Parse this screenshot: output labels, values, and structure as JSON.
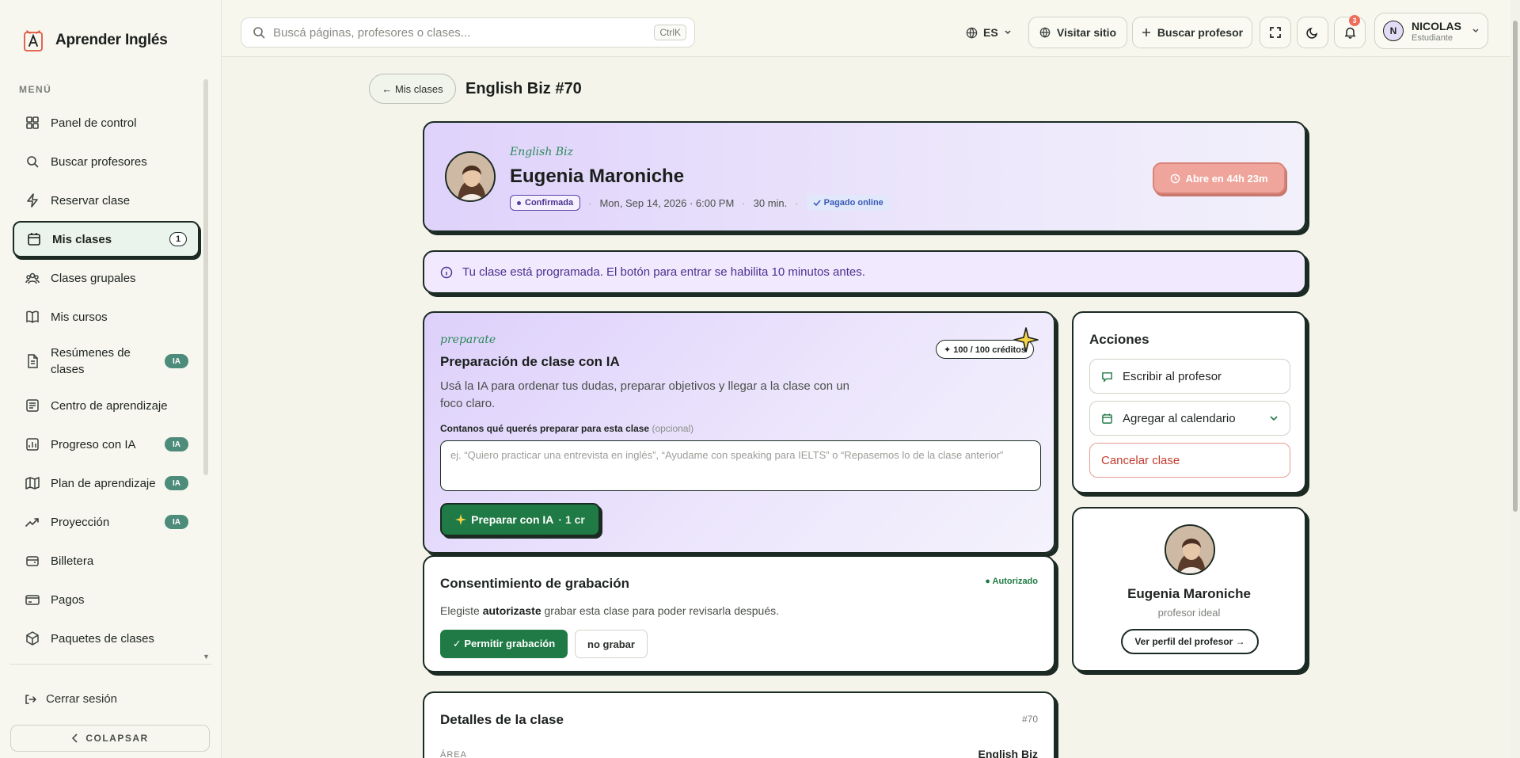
{
  "brand": {
    "name": "Aprender Inglés"
  },
  "sidebar": {
    "menu_label": "MENÚ",
    "items": [
      {
        "label": "Panel de control",
        "icon": "grid-icon"
      },
      {
        "label": "Buscar profesores",
        "icon": "search-icon"
      },
      {
        "label": "Reservar clase",
        "icon": "bolt-icon"
      },
      {
        "label": "Mis clases",
        "icon": "calendar-icon",
        "badge": "1",
        "active": true
      },
      {
        "label": "Clases grupales",
        "icon": "group-icon"
      },
      {
        "label": "Mis cursos",
        "icon": "book-icon"
      },
      {
        "label": "Resúmenes de clases",
        "icon": "document-icon",
        "badge": "IA"
      },
      {
        "label": "Centro de aprendizaje",
        "icon": "notes-icon"
      },
      {
        "label": "Progreso con IA",
        "icon": "chart-icon",
        "badge": "IA"
      },
      {
        "label": "Plan de aprendizaje",
        "icon": "map-icon",
        "badge": "IA"
      },
      {
        "label": "Proyección",
        "icon": "trend-icon",
        "badge": "IA"
      },
      {
        "label": "Billetera",
        "icon": "wallet-icon"
      },
      {
        "label": "Pagos",
        "icon": "card-icon"
      },
      {
        "label": "Paquetes de clases",
        "icon": "box-icon"
      }
    ],
    "logout": "Cerrar sesión",
    "collapse": "COLAPSAR"
  },
  "topbar": {
    "search_placeholder": "Buscá páginas, profesores o clases...",
    "search_shortcut": "CtrlK",
    "language": "ES",
    "visit_site": "Visitar sitio",
    "find_teacher": "Buscar profesor",
    "notifications_count": "3",
    "user": {
      "initial": "N",
      "name": "NICOLAS",
      "role": "Estudiante"
    }
  },
  "page": {
    "back": "← Mis clases",
    "title": "English Biz #70"
  },
  "lesson": {
    "course": "English Biz",
    "teacher": "Eugenia Maroniche",
    "status": "Confirmada",
    "datetime": "Mon, Sep 14, 2026 · 6:00 PM",
    "duration": "30 min.",
    "payment": "Pagado online",
    "open_in": "Abre en 44h 23m"
  },
  "info_banner": "Tu clase está programada. El botón para entrar se habilita 10 minutos antes.",
  "prep": {
    "kicker": "preparate",
    "title": "Preparación de clase con IA",
    "credits": "✦ 100 / 100 créditos",
    "description": "Usá la IA para ordenar tus dudas, preparar objetivos y llegar a la clase con un foco claro.",
    "field_label": "Contanos qué querés preparar para esta clase",
    "field_optional": "(opcional)",
    "field_placeholder": "ej. “Quiero practicar una entrevista en inglés”, “Ayudame con speaking para IELTS” o “Repasemos lo de la clase anterior”",
    "button": "Preparar con IA",
    "button_cost": "· 1 cr"
  },
  "consent": {
    "title": "Consentimiento de grabación",
    "status": "● Autorizado",
    "text_pre": "Elegiste ",
    "text_bold": "autorizaste",
    "text_post": " grabar esta clase para poder revisarla después.",
    "allow": "✓ Permitir grabación",
    "deny": "no grabar"
  },
  "details": {
    "title": "Detalles de la clase",
    "id": "#70",
    "area_label": "ÁREA",
    "area_value": "English Biz"
  },
  "actions": {
    "title": "Acciones",
    "write": "Escribir al profesor",
    "calendar": "Agregar al calendario",
    "cancel": "Cancelar clase"
  },
  "profile": {
    "name": "Eugenia Maroniche",
    "subtitle": "profesor ideal",
    "button": "Ver perfil del profesor →"
  },
  "colors": {
    "accent_green": "#1f7a45",
    "lavender": "#dfd2fb",
    "ink": "#1b2a22",
    "coral": "#efa59b"
  }
}
